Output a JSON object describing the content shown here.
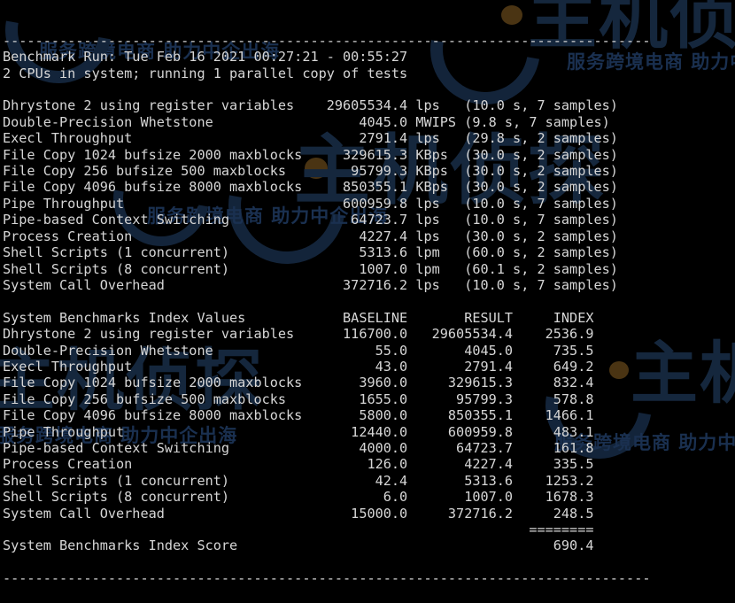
{
  "terminal": {
    "divider_top": "--------------------------------------------------------------------------------",
    "divider_bottom": "--------------------------------------------------------------------------------",
    "header": {
      "run_line": "Benchmark Run: Tue Feb 16 2021 00:27:21 - 00:55:27",
      "cpu_line": "2 CPUs in system; running 1 parallel copy of tests",
      "date": "Tue Feb 16 2021",
      "time_start": "00:27:21",
      "time_end": "00:55:27",
      "cpu_count": "2",
      "parallel_copies": "1"
    },
    "results": {
      "rows": [
        {
          "name": "Dhrystone 2 using register variables",
          "value": "29605534.4",
          "unit": "lps",
          "duration": "10.0 s",
          "samples": "7 samples"
        },
        {
          "name": "Double-Precision Whetstone",
          "value": "4045.0",
          "unit": "MWIPS",
          "duration": "9.8 s",
          "samples": "7 samples"
        },
        {
          "name": "Execl Throughput",
          "value": "2791.4",
          "unit": "lps",
          "duration": "29.8 s",
          "samples": "2 samples"
        },
        {
          "name": "File Copy 1024 bufsize 2000 maxblocks",
          "value": "329615.3",
          "unit": "KBps",
          "duration": "30.0 s",
          "samples": "2 samples"
        },
        {
          "name": "File Copy 256 bufsize 500 maxblocks",
          "value": "95799.3",
          "unit": "KBps",
          "duration": "30.0 s",
          "samples": "2 samples"
        },
        {
          "name": "File Copy 4096 bufsize 8000 maxblocks",
          "value": "850355.1",
          "unit": "KBps",
          "duration": "30.0 s",
          "samples": "2 samples"
        },
        {
          "name": "Pipe Throughput",
          "value": "600959.8",
          "unit": "lps",
          "duration": "10.0 s",
          "samples": "7 samples"
        },
        {
          "name": "Pipe-based Context Switching",
          "value": "64723.7",
          "unit": "lps",
          "duration": "10.0 s",
          "samples": "7 samples"
        },
        {
          "name": "Process Creation",
          "value": "4227.4",
          "unit": "lps",
          "duration": "30.0 s",
          "samples": "2 samples"
        },
        {
          "name": "Shell Scripts (1 concurrent)",
          "value": "5313.6",
          "unit": "lpm",
          "duration": "60.0 s",
          "samples": "2 samples"
        },
        {
          "name": "Shell Scripts (8 concurrent)",
          "value": "1007.0",
          "unit": "lpm",
          "duration": "60.1 s",
          "samples": "2 samples"
        },
        {
          "name": "System Call Overhead",
          "value": "372716.2",
          "unit": "lps",
          "duration": "10.0 s",
          "samples": "7 samples"
        }
      ]
    },
    "index": {
      "title": "System Benchmarks Index Values",
      "columns": [
        "BASELINE",
        "RESULT",
        "INDEX"
      ],
      "rows": [
        {
          "name": "Dhrystone 2 using register variables",
          "baseline": "116700.0",
          "result": "29605534.4",
          "index": "2536.9"
        },
        {
          "name": "Double-Precision Whetstone",
          "baseline": "55.0",
          "result": "4045.0",
          "index": "735.5"
        },
        {
          "name": "Execl Throughput",
          "baseline": "43.0",
          "result": "2791.4",
          "index": "649.2"
        },
        {
          "name": "File Copy 1024 bufsize 2000 maxblocks",
          "baseline": "3960.0",
          "result": "329615.3",
          "index": "832.4"
        },
        {
          "name": "File Copy 256 bufsize 500 maxblocks",
          "baseline": "1655.0",
          "result": "95799.3",
          "index": "578.8"
        },
        {
          "name": "File Copy 4096 bufsize 8000 maxblocks",
          "baseline": "5800.0",
          "result": "850355.1",
          "index": "1466.1"
        },
        {
          "name": "Pipe Throughput",
          "baseline": "12440.0",
          "result": "600959.8",
          "index": "483.1"
        },
        {
          "name": "Pipe-based Context Switching",
          "baseline": "4000.0",
          "result": "64723.7",
          "index": "161.8"
        },
        {
          "name": "Process Creation",
          "baseline": "126.0",
          "result": "4227.4",
          "index": "335.5"
        },
        {
          "name": "Shell Scripts (1 concurrent)",
          "baseline": "42.4",
          "result": "5313.6",
          "index": "1253.2"
        },
        {
          "name": "Shell Scripts (8 concurrent)",
          "baseline": "6.0",
          "result": "1007.0",
          "index": "1678.3"
        },
        {
          "name": "System Call Overhead",
          "baseline": "15000.0",
          "result": "372716.2",
          "index": "248.5"
        }
      ],
      "score_separator": "========",
      "score_label": "System Benchmarks Index Score",
      "score_value": "690.4"
    }
  },
  "watermarks": {
    "logo_text": "主机侦探",
    "tagline": "服务跨境电商 助力中企出海",
    "color": "#16283f"
  }
}
